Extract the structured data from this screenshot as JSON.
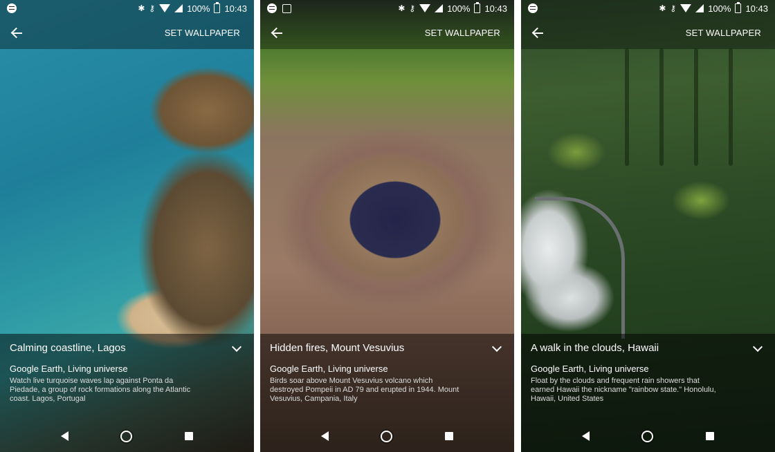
{
  "status": {
    "battery": "100%",
    "time": "10:43"
  },
  "appbar": {
    "set_wallpaper_label": "SET WALLPAPER"
  },
  "screens": [
    {
      "title": "Calming coastline, Lagos",
      "source": "Google Earth, Living universe",
      "description": "Watch live turquoise waves lap against Ponta da Piedade, a group of rock formations along the Atlantic coast. Lagos, Portugal"
    },
    {
      "title": "Hidden fires, Mount Vesuvius",
      "source": "Google Earth, Living universe",
      "description": "Birds soar above Mount Vesuvius volcano which destroyed Pompeii in AD 79 and erupted in 1944. Mount Vesuvius, Campania, Italy"
    },
    {
      "title": "A walk in the clouds, Hawaii",
      "source": "Google Earth, Living universe",
      "description": "Float by the clouds and frequent rain showers that earned Hawaii the nickname \"rainbow state.\" Honolulu, Hawaii, United States"
    }
  ],
  "icons": {
    "status_left": [
      "spotify-icon",
      "image-icon"
    ],
    "status_right": [
      "bluetooth-icon",
      "vpn-key-icon",
      "wifi-icon",
      "signal-icon",
      "battery-icon"
    ],
    "appbar": [
      "back-arrow-icon"
    ],
    "panel": [
      "chevron-down-icon"
    ],
    "navbar": [
      "nav-back-icon",
      "nav-home-icon",
      "nav-recents-icon"
    ]
  }
}
